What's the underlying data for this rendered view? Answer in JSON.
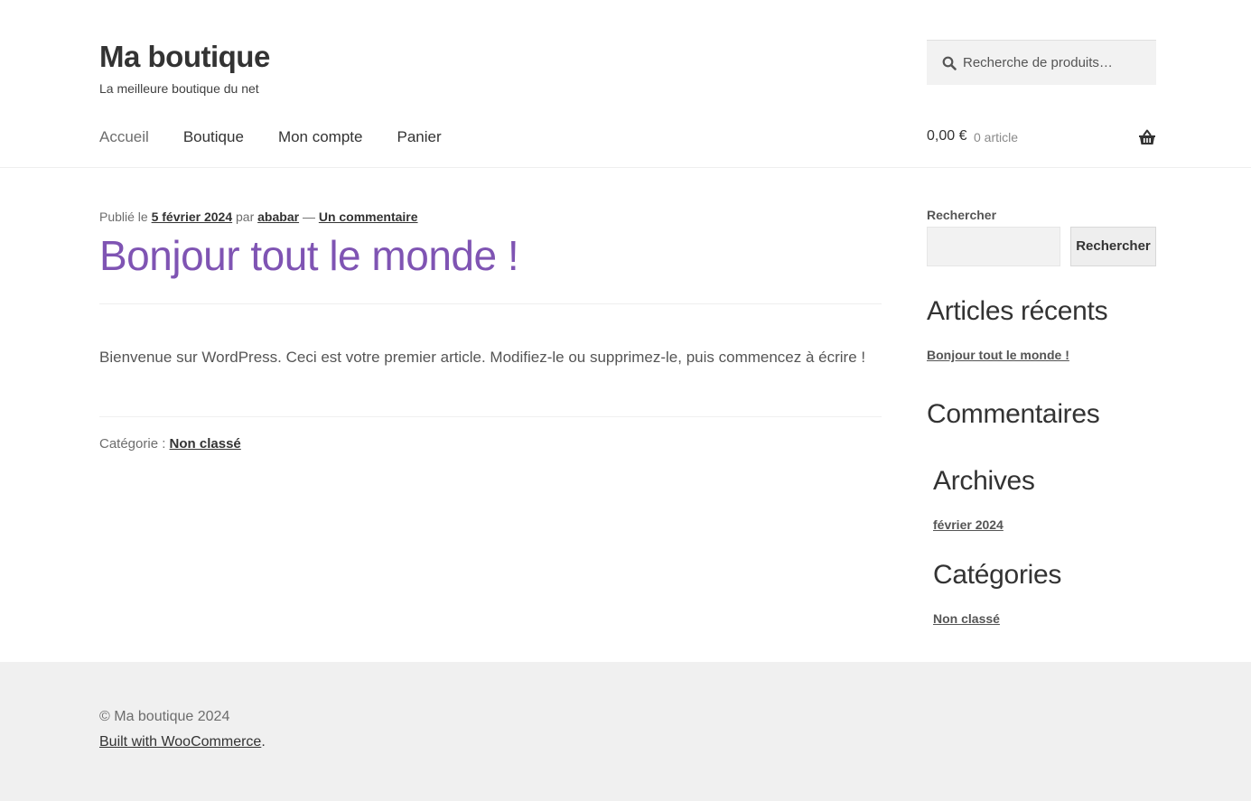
{
  "header": {
    "site_title": "Ma boutique",
    "tagline": "La meilleure boutique du net",
    "search_placeholder": "Recherche de produits…",
    "nav": [
      "Accueil",
      "Boutique",
      "Mon compte",
      "Panier"
    ],
    "cart_amount": "0,00 €",
    "cart_count": "0 article"
  },
  "post": {
    "meta_prefix": "Publié le",
    "date": "5 février 2024",
    "meta_by": "par",
    "author": "ababar",
    "meta_sep": "—",
    "comments_link": "Un commentaire",
    "title": "Bonjour tout le monde !",
    "body": "Bienvenue sur WordPress. Ceci est votre premier article. Modifiez-le ou supprimez-le, puis commencez à écrire !",
    "category_label": "Catégorie :",
    "category": "Non classé"
  },
  "sidebar": {
    "search_label": "Rechercher",
    "search_button": "Rechercher",
    "recent_title": "Articles récents",
    "recent_items": [
      "Bonjour tout le monde !"
    ],
    "comments_title": "Commentaires",
    "archives_title": "Archives",
    "archives_items": [
      "février 2024"
    ],
    "categories_title": "Catégories",
    "categories_items": [
      "Non classé"
    ]
  },
  "footer": {
    "copyright": "© Ma boutique 2024",
    "built_link": "Built with WooCommerce",
    "built_suffix": "."
  },
  "colors": {
    "accent": "#7f54b3",
    "text": "#333333",
    "footer_bg": "#f0f0f0"
  },
  "icons": [
    "search-icon",
    "basket-icon"
  ]
}
